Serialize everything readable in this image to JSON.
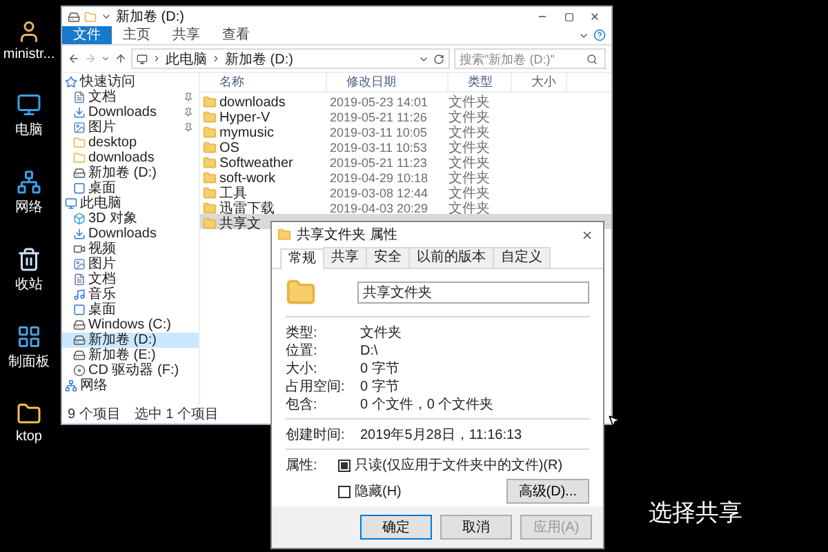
{
  "desktop_icons": [
    {
      "label": "ministr...",
      "kind": "user"
    },
    {
      "label": "电脑",
      "kind": "computer"
    },
    {
      "label": "网络",
      "kind": "network"
    },
    {
      "label": "收站",
      "kind": "trash"
    },
    {
      "label": "制面板",
      "kind": "control"
    },
    {
      "label": "ktop",
      "kind": "folder"
    }
  ],
  "explorer": {
    "title": "新加卷 (D:)",
    "ribbon_tabs": [
      {
        "label": "文件",
        "kind": "file_menu"
      },
      {
        "label": "主页",
        "kind": "tab"
      },
      {
        "label": "共享",
        "kind": "tab"
      },
      {
        "label": "查看",
        "kind": "tab"
      }
    ],
    "breadcrumb": [
      "此电脑",
      "新加卷 (D:)"
    ],
    "search": {
      "placeholder": "搜索\"新加卷 (D:)\""
    },
    "nav": [
      {
        "label": "快速访问",
        "kind": "star",
        "selected": false,
        "children": [
          {
            "label": "文档",
            "kind": "doc",
            "selected": false,
            "pinned": true
          },
          {
            "label": "Downloads",
            "kind": "download",
            "selected": false,
            "pinned": true
          },
          {
            "label": "图片",
            "kind": "image",
            "selected": false,
            "pinned": true
          },
          {
            "label": "desktop",
            "kind": "folder",
            "selected": false,
            "pinned": false
          },
          {
            "label": "downloads",
            "kind": "folder",
            "selected": false,
            "pinned": false
          },
          {
            "label": "新加卷 (D:)",
            "kind": "drive",
            "selected": false,
            "pinned": false
          },
          {
            "label": "桌面",
            "kind": "desk",
            "selected": false,
            "pinned": false
          }
        ]
      },
      {
        "label": "此电脑",
        "kind": "pc",
        "selected": false,
        "children": [
          {
            "label": "3D 对象",
            "kind": "cube",
            "selected": false
          },
          {
            "label": "Downloads",
            "kind": "download",
            "selected": false
          },
          {
            "label": "视频",
            "kind": "video",
            "selected": false
          },
          {
            "label": "图片",
            "kind": "image",
            "selected": false
          },
          {
            "label": "文档",
            "kind": "doc",
            "selected": false
          },
          {
            "label": "音乐",
            "kind": "music",
            "selected": false
          },
          {
            "label": "桌面",
            "kind": "desk",
            "selected": false
          },
          {
            "label": "Windows (C:)",
            "kind": "drive",
            "selected": false
          },
          {
            "label": "新加卷 (D:)",
            "kind": "drive",
            "selected": true
          },
          {
            "label": "新加卷 (E:)",
            "kind": "drive",
            "selected": false
          },
          {
            "label": "CD 驱动器 (F:)",
            "kind": "disc",
            "selected": false
          }
        ]
      },
      {
        "label": "网络",
        "kind": "network",
        "selected": false
      }
    ],
    "columns": [
      "名称",
      "修改日期",
      "类型",
      "大小"
    ],
    "rows": [
      {
        "name": "downloads",
        "modified": "2019-05-23 14:01",
        "type": "文件夹",
        "selected": false
      },
      {
        "name": "Hyper-V",
        "modified": "2019-05-21 11:26",
        "type": "文件夹",
        "selected": false
      },
      {
        "name": "mymusic",
        "modified": "2019-03-11 10:05",
        "type": "文件夹",
        "selected": false
      },
      {
        "name": "OS",
        "modified": "2019-03-11 10:53",
        "type": "文件夹",
        "selected": false
      },
      {
        "name": "Softweather",
        "modified": "2019-05-21 11:23",
        "type": "文件夹",
        "selected": false
      },
      {
        "name": "soft-work",
        "modified": "2019-04-29 10:18",
        "type": "文件夹",
        "selected": false
      },
      {
        "name": "工具",
        "modified": "2019-03-08 12:44",
        "type": "文件夹",
        "selected": false
      },
      {
        "name": "迅雷下载",
        "modified": "2019-04-03 20:29",
        "type": "文件夹",
        "selected": false
      },
      {
        "name": "共享文",
        "selected": true
      }
    ],
    "status": [
      "9 个项目",
      "选中 1 个项目"
    ]
  },
  "dialog": {
    "title": "共享文件夹 属性",
    "tabs": [
      {
        "label": "常规",
        "selected": true
      },
      {
        "label": "共享",
        "selected": false
      },
      {
        "label": "安全",
        "selected": false
      },
      {
        "label": "以前的版本",
        "selected": false
      },
      {
        "label": "自定义",
        "selected": false
      }
    ],
    "name": "共享文件夹",
    "info": [
      {
        "label": "类型:",
        "value": "文件夹"
      },
      {
        "label": "位置:",
        "value": "D:\\"
      },
      {
        "label": "大小:",
        "value": "0 字节"
      },
      {
        "label": "占用空间:",
        "value": "0 字节"
      },
      {
        "label": "包含:",
        "value": "0 个文件，0 个文件夹"
      }
    ],
    "created": {
      "label": "创建时间:",
      "value": "2019年5月28日，11:16:13"
    },
    "attributes_label": "属性:",
    "attributes": [
      {
        "label": "只读(仅应用于文件夹中的文件)(R)",
        "checked": true
      },
      {
        "label": "隐藏(H)",
        "checked": false
      }
    ],
    "advanced": "高级(D)...",
    "buttons": [
      {
        "label": "确定",
        "default": true,
        "disabled": false
      },
      {
        "label": "取消",
        "default": false,
        "disabled": false
      },
      {
        "label": "应用(A)",
        "default": false,
        "disabled": true
      }
    ]
  },
  "subtitle": "选择共享"
}
